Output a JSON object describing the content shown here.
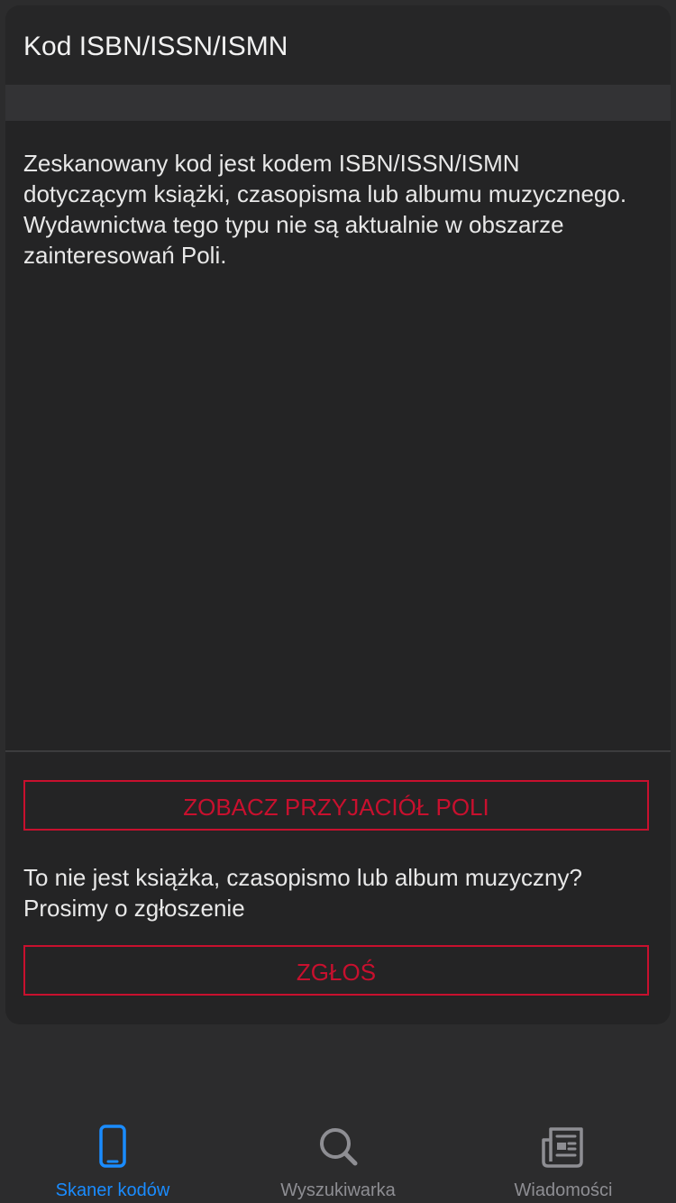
{
  "card": {
    "title": "Kod ISBN/ISSN/ISMN",
    "description": "Zeskanowany kod jest kodem ISBN/ISSN/ISMN\ndotyczącym książki,  czasopisma lub albumu muzycznego.\nWydawnictwa tego typu nie są aktualnie w obszarze\nzainteresowań Poli.",
    "friends_button_label": "ZOBACZ PRZYJACIÓŁ POLI",
    "report_prompt": "To nie jest książka, czasopismo lub album muzyczny?\nProsimy o zgłoszenie",
    "report_button_label": "ZGŁOŚ"
  },
  "tabbar": {
    "tabs": [
      {
        "label": "Skaner kodów",
        "icon": "phone-icon",
        "active": true
      },
      {
        "label": "Wyszukiwarka",
        "icon": "search-icon",
        "active": false
      },
      {
        "label": "Wiadomości",
        "icon": "newspaper-icon",
        "active": false
      }
    ]
  },
  "colors": {
    "accent_red": "#c8102e",
    "active_tab": "#1a8cff",
    "inactive_tab": "#8e8e93",
    "background": "#2c2c2d",
    "card": "#242425"
  }
}
